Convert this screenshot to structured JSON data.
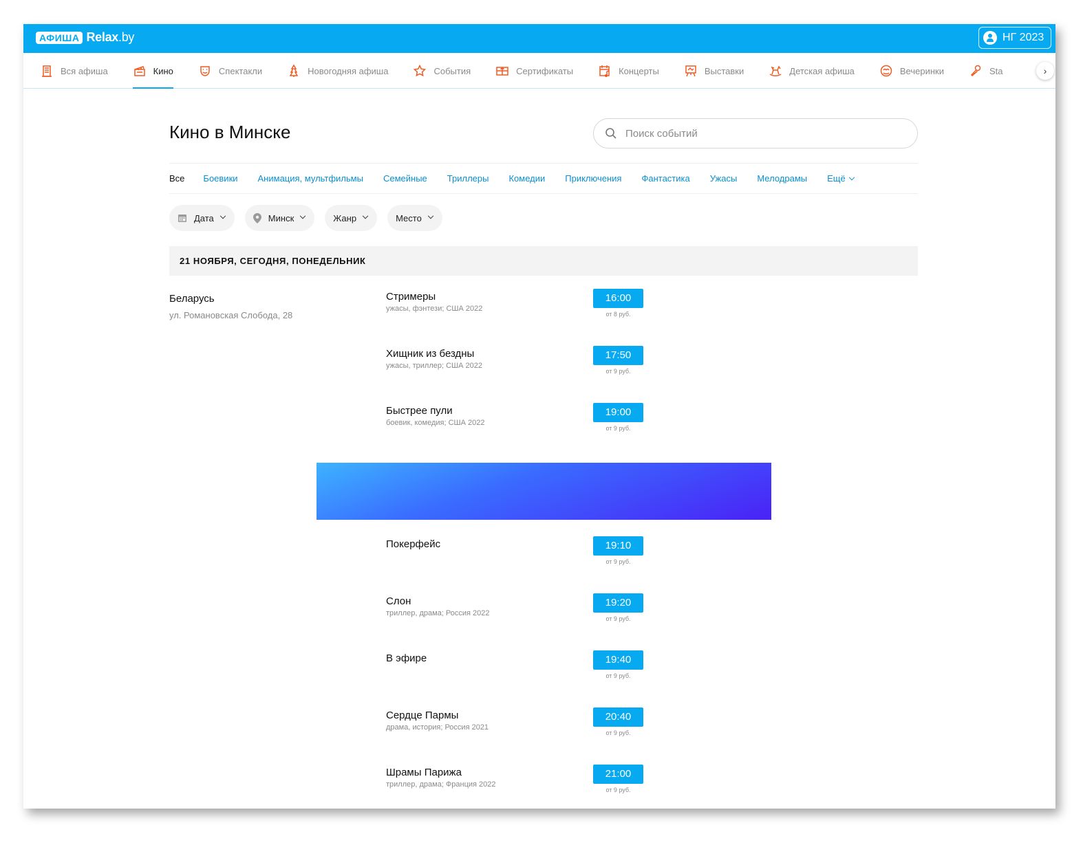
{
  "brand": {
    "badge": "АФИША",
    "name": "Relax",
    "tld": ".by"
  },
  "header_button": {
    "label": "НГ 2023"
  },
  "categories": [
    {
      "label": "Вся афиша",
      "icon": "building-icon"
    },
    {
      "label": "Кино",
      "icon": "clapperboard-icon",
      "active": true
    },
    {
      "label": "Спектакли",
      "icon": "theater-mask-icon"
    },
    {
      "label": "Новогодняя афиша",
      "icon": "christmas-tree-icon"
    },
    {
      "label": "События",
      "icon": "star-icon"
    },
    {
      "label": "Сертификаты",
      "icon": "gift-card-icon"
    },
    {
      "label": "Концерты",
      "icon": "calendar-music-icon"
    },
    {
      "label": "Выставки",
      "icon": "easel-icon"
    },
    {
      "label": "Детская афиша",
      "icon": "rocking-horse-icon"
    },
    {
      "label": "Вечеринки",
      "icon": "disco-icon"
    },
    {
      "label": "Sta",
      "icon": "microphone-icon"
    }
  ],
  "colors": {
    "accent": "#07aaf0",
    "category_icon": "#f05a22"
  },
  "page": {
    "title": "Кино в Минске"
  },
  "search": {
    "placeholder": "Поиск событий"
  },
  "genres": [
    "Все",
    "Боевики",
    "Анимация, мультфильмы",
    "Семейные",
    "Триллеры",
    "Комедии",
    "Приключения",
    "Фантастика",
    "Ужасы",
    "Мелодрамы"
  ],
  "genres_more": "Ещё",
  "filters": {
    "date": "Дата",
    "city": "Минск",
    "genre": "Жанр",
    "place": "Место"
  },
  "date_header": "21 НОЯБРЯ, СЕГОДНЯ, ПОНЕДЕЛЬНИК",
  "cinema": {
    "name": "Беларусь",
    "address": "ул. Романовская Слобода, 28"
  },
  "movies": [
    {
      "title": "Стримеры",
      "meta": "ужасы, фэнтези; США 2022",
      "time": "16:00",
      "price": "от 8 руб."
    },
    {
      "title": "Хищник из бездны",
      "meta": "ужасы, триллер; США 2022",
      "time": "17:50",
      "price": "от 9 руб."
    },
    {
      "title": "Быстрее пули",
      "meta": "боевик, комедия; США 2022",
      "time": "19:00",
      "price": "от 9 руб."
    },
    {
      "title": "Покерфейс",
      "meta": "",
      "time": "19:10",
      "price": "от 9 руб."
    },
    {
      "title": "Слон",
      "meta": "триллер, драма; Россия 2022",
      "time": "19:20",
      "price": "от 9 руб."
    },
    {
      "title": "В эфире",
      "meta": "",
      "time": "19:40",
      "price": "от 9 руб."
    },
    {
      "title": "Сердце Пармы",
      "meta": "драма, история; Россия 2021",
      "time": "20:40",
      "price": "от 9 руб."
    },
    {
      "title": "Шрамы Парижа",
      "meta": "триллер, драма; Франция 2022",
      "time": "21:00",
      "price": "от 9 руб."
    }
  ]
}
